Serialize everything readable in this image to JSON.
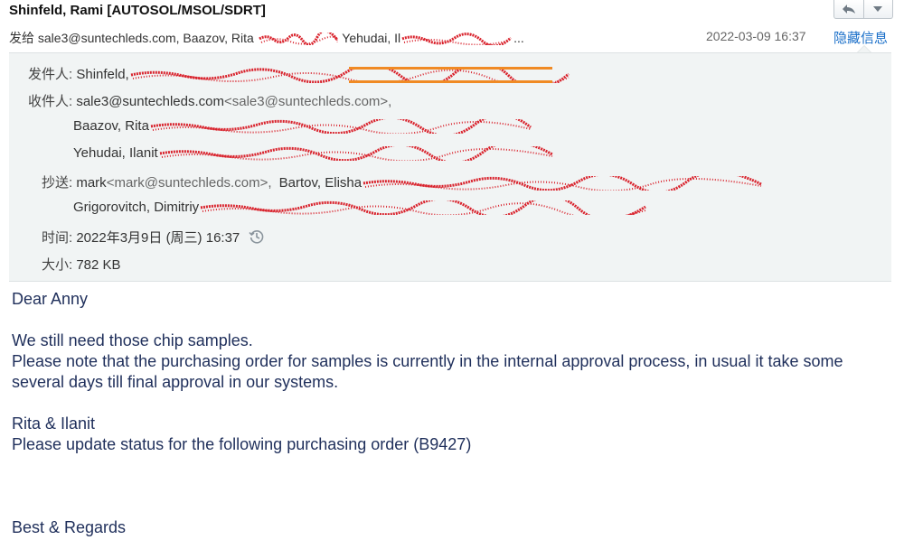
{
  "header": {
    "sender_title": "Shinfeld, Rami [AUTOSOL/MSOL/SDRT]",
    "to_prefix": "发给",
    "to_summary_visible": "sale3@suntechleds.com, Baazov, Rita",
    "to_summary_name3": "Yehudai, Il",
    "ellipsis": "...",
    "date": "2022-03-09 16:37",
    "hide_info_label": "隐藏信息"
  },
  "toolbar": {
    "reply_icon": "reply-icon",
    "dropdown_icon": "triangle-down-icon"
  },
  "details": {
    "from_label": "发件人:",
    "from_name": "Shinfeld,",
    "to_label": "收件人:",
    "to_email_name": "sale3@suntechleds.com",
    "to_email_addr": "<sale3@suntechleds.com>,",
    "to_2": "Baazov, Rita",
    "to_3": "Yehudai, Ilanit",
    "cc_label": "抄送:",
    "cc_name": "mark",
    "cc_addr": "<mark@suntechleds.com>,",
    "cc_2": "Bartov, Elisha",
    "cc_3": "Grigorovitch, Dimitriy",
    "time_label": "时间:",
    "time_value": "2022年3月9日 (周三) 16:37",
    "size_label": "大小:",
    "size_value": "782 KB",
    "history_icon": "clock-history-icon",
    "redaction_color": "#d9232d",
    "highlight_color": "#f08a24"
  },
  "body": {
    "lines": [
      "Dear Anny",
      "",
      "We still need those chip samples.",
      "Please note that the purchasing order for samples is currently in the internal approval process, in usual it take some several days till final approval in our systems.",
      "",
      "Rita & Ilanit",
      "Please update status for the following purchasing order (B9427)",
      "",
      "",
      "",
      "Best & Regards"
    ]
  }
}
